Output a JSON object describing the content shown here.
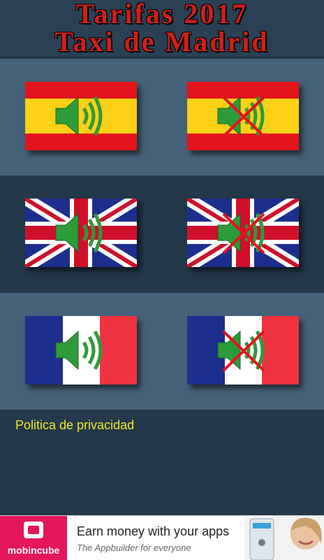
{
  "header": {
    "title_line1": "Tarifas 2017",
    "title_line2": "Taxi de Madrid"
  },
  "rows": [
    {
      "language": "spanish",
      "left": "speaker-on-icon",
      "right": "speaker-muted-icon"
    },
    {
      "language": "english",
      "left": "speaker-on-icon",
      "right": "speaker-muted-icon"
    },
    {
      "language": "french",
      "left": "speaker-on-icon",
      "right": "speaker-muted-icon"
    }
  ],
  "privacy": {
    "label": "Politica de privacidad"
  },
  "ad": {
    "brand": "mobincube",
    "headline": "Earn money with your apps",
    "subline": "The Appbuilder for everyone"
  },
  "colors": {
    "header_bg": "#2a4054",
    "title_red": "#d21f17",
    "row_light": "#45627a",
    "row_dark": "#23384a",
    "privacy_text": "#f1e82a",
    "ad_brand": "#e3175b"
  }
}
